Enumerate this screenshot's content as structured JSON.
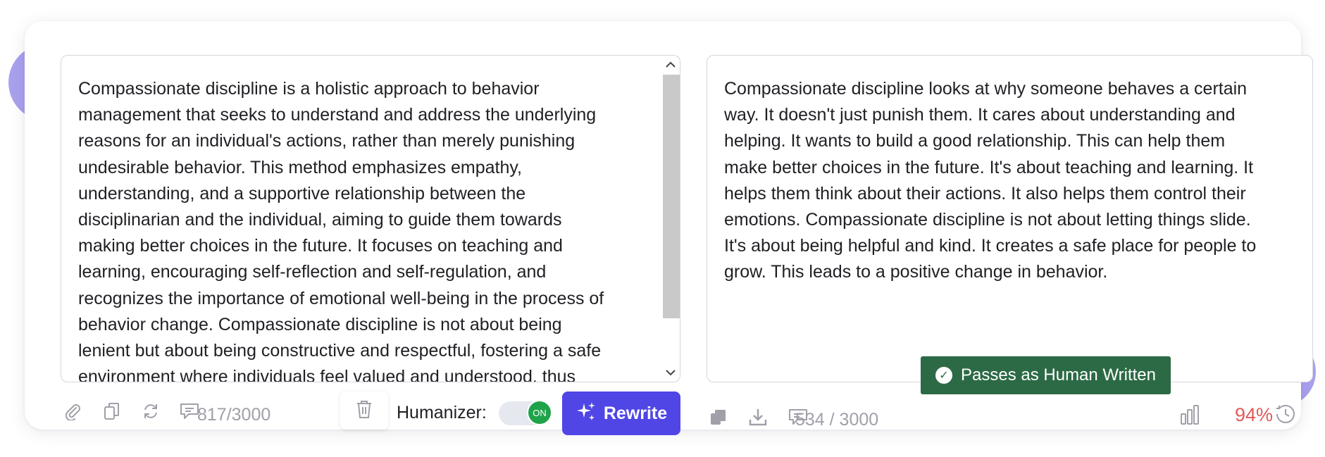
{
  "input": {
    "text": "Compassionate discipline is a holistic approach to behavior\nmanagement that seeks to understand and address the underlying\nreasons for an individual's actions, rather than merely punishing\nundesirable behavior. This method emphasizes empathy,\nunderstanding, and a supportive relationship between the\ndisciplinarian and the individual, aiming to guide them towards\nmaking better choices in the future. It focuses on teaching and\nlearning, encouraging self-reflection and self-regulation, and\nrecognizes the importance of emotional well-being in the process of\nbehavior change. Compassionate discipline is not about being\nlenient but about being constructive and respectful, fostering a safe\nenvironment where individuals feel valued and understood, thus",
    "counter": "817/3000"
  },
  "output": {
    "text": "Compassionate discipline looks at why someone behaves a certain\nway. It doesn't just punish them. It cares about understanding and\nhelping. It wants to build a good relationship. This can help them\nmake better choices in the future. It's about teaching and learning. It\nhelps them think about their actions. It also helps them control their\nemotions. Compassionate discipline is not about letting things slide.\nIt's about being helpful and kind. It creates a safe place for people to\ngrow. This leads to a positive change in behavior.",
    "counter": "534 / 3000",
    "badge": "Passes as Human Written",
    "score": "94%"
  },
  "controls": {
    "humanizer_label": "Humanizer:",
    "toggle_label": "ON",
    "rewrite_label": "Rewrite"
  },
  "icons": {
    "input_toolbar": [
      "attach-icon",
      "copy-icon",
      "refresh-icon",
      "comment-icon"
    ],
    "trash": "trash-icon",
    "rewrite": "sparkle-icon",
    "output_toolbar": [
      "copy-icon",
      "download-icon",
      "comment-icon"
    ],
    "score": "bar-chart-icon",
    "history": "history-icon",
    "badge": "check-circle-icon"
  },
  "colors": {
    "accent": "#5046e5",
    "badge_bg": "#2c6a45",
    "toggle_on": "#1fa34a",
    "score_text": "#e15a5a",
    "blob": "#a9a1ee"
  }
}
